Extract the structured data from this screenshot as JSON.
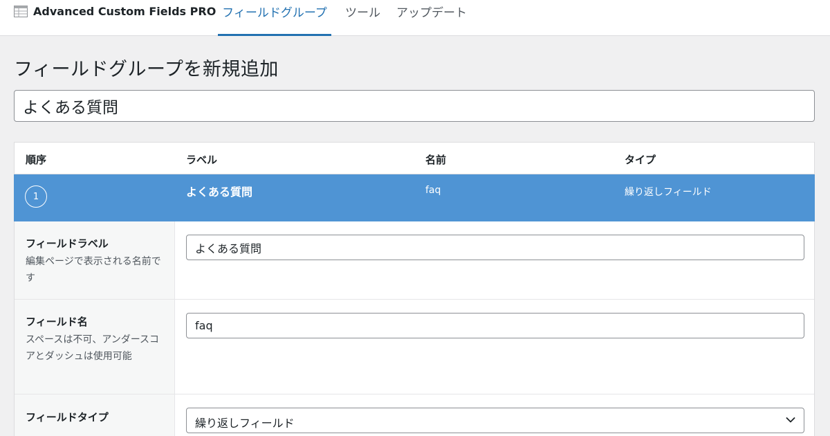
{
  "header": {
    "brand": "Advanced Custom Fields PRO",
    "brand_icon": "table-icon",
    "tabs": [
      {
        "label": "フィールドグループ",
        "active": true
      },
      {
        "label": "ツール",
        "active": false
      },
      {
        "label": "アップデート",
        "active": false
      }
    ]
  },
  "page": {
    "title": "フィールドグループを新規追加",
    "group_title_value": "よくある質問"
  },
  "table": {
    "columns": [
      "順序",
      "ラベル",
      "名前",
      "タイプ"
    ],
    "rows": [
      {
        "order": "1",
        "label": "よくある質問",
        "name": "faq",
        "type": "繰り返しフィールド"
      }
    ]
  },
  "settings": {
    "field_label": {
      "label": "フィールドラベル",
      "description": "編集ページで表示される名前です",
      "value": "よくある質問"
    },
    "field_name": {
      "label": "フィールド名",
      "description": "スペースは不可、アンダースコアとダッシュは使用可能",
      "value": "faq"
    },
    "field_type": {
      "label": "フィールドタイプ",
      "value": "繰り返しフィールド"
    }
  },
  "colors": {
    "accent": "#2271b1",
    "active_row": "#4f94d4"
  }
}
